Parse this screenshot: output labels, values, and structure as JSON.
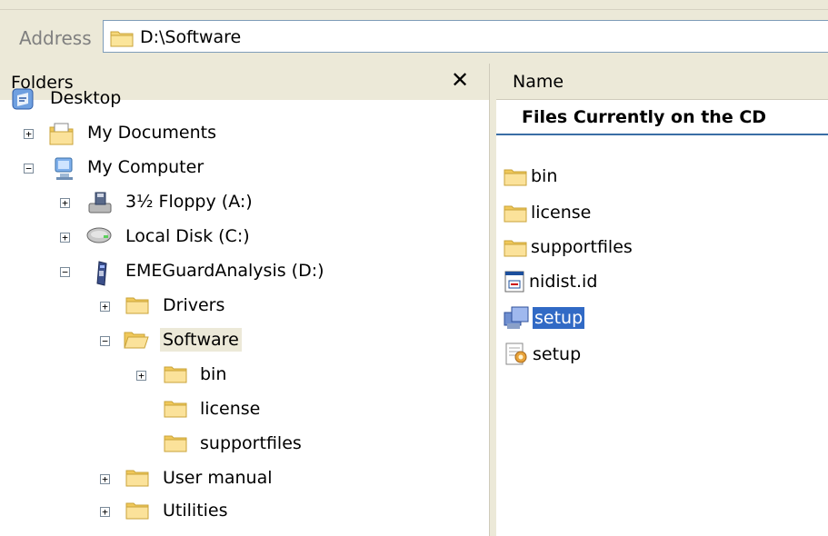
{
  "address": {
    "label": "Address",
    "path": "D:\\Software"
  },
  "folders_pane": {
    "title": "Folders",
    "close": "✕",
    "tree": [
      {
        "label": "Desktop",
        "icon": "desktop-icon",
        "expander": ""
      },
      {
        "label": "My Documents",
        "icon": "my-documents-icon",
        "expander": "+"
      },
      {
        "label": "My Computer",
        "icon": "my-computer-icon",
        "expander": "−"
      },
      {
        "label": "3½ Floppy (A:)",
        "icon": "floppy-drive-icon",
        "expander": "+"
      },
      {
        "label": "Local Disk (C:)",
        "icon": "hard-disk-icon",
        "expander": "+"
      },
      {
        "label": "EMEGuardAnalysis (D:)",
        "icon": "cd-drive-icon",
        "expander": "−"
      },
      {
        "label": "Drivers",
        "icon": "folder-icon",
        "expander": "+"
      },
      {
        "label": "Software",
        "icon": "folder-open-icon",
        "expander": "−",
        "selected": true
      },
      {
        "label": "bin",
        "icon": "folder-icon",
        "expander": "+"
      },
      {
        "label": "license",
        "icon": "folder-icon",
        "expander": ""
      },
      {
        "label": "supportfiles",
        "icon": "folder-icon",
        "expander": ""
      },
      {
        "label": "User manual",
        "icon": "folder-icon",
        "expander": "+"
      },
      {
        "label": "Utilities",
        "icon": "folder-icon",
        "expander": "+"
      }
    ]
  },
  "content_pane": {
    "column_header": "Name",
    "group_title": "Files Currently on the CD",
    "files": [
      {
        "label": "bin",
        "icon": "folder-icon"
      },
      {
        "label": "license",
        "icon": "folder-icon"
      },
      {
        "label": "supportfiles",
        "icon": "folder-icon"
      },
      {
        "label": "nidist.id",
        "icon": "id-file-icon"
      },
      {
        "label": "setup",
        "icon": "setup-exe-icon",
        "selected": true
      },
      {
        "label": "setup",
        "icon": "setup-ini-icon"
      }
    ]
  },
  "colors": {
    "chrome": "#ece9d8",
    "selection": "#316ac5",
    "folder": "#f5d77a"
  }
}
